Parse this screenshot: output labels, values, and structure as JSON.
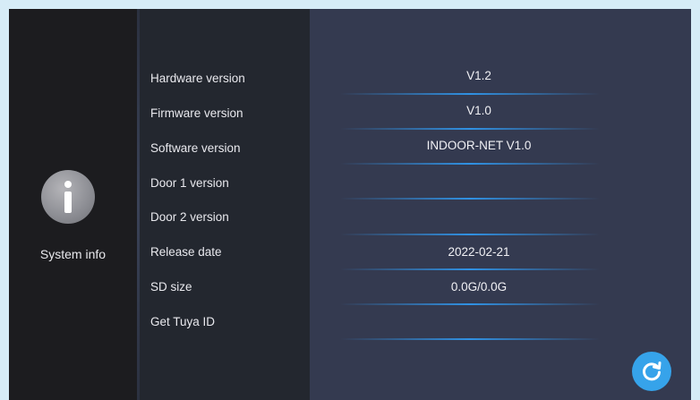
{
  "sidebar": {
    "icon": "info-icon",
    "label": "System info"
  },
  "rows": [
    {
      "label": "Hardware version",
      "value": "V1.2"
    },
    {
      "label": "Firmware version",
      "value": "V1.0"
    },
    {
      "label": "Software version",
      "value": "INDOOR-NET V1.0"
    },
    {
      "label": "Door 1 version",
      "value": ""
    },
    {
      "label": "Door 2 version",
      "value": ""
    },
    {
      "label": "Release date",
      "value": "2022-02-21"
    },
    {
      "label": "SD size",
      "value": "0.0G/0.0G"
    },
    {
      "label": "Get Tuya ID",
      "value": ""
    }
  ],
  "refresh_button": {
    "icon": "refresh-icon"
  },
  "colors": {
    "accent": "#36a3ea",
    "panel_dark": "#1c1c1f",
    "panel_right": "#343a50",
    "line": "#3096eb"
  }
}
